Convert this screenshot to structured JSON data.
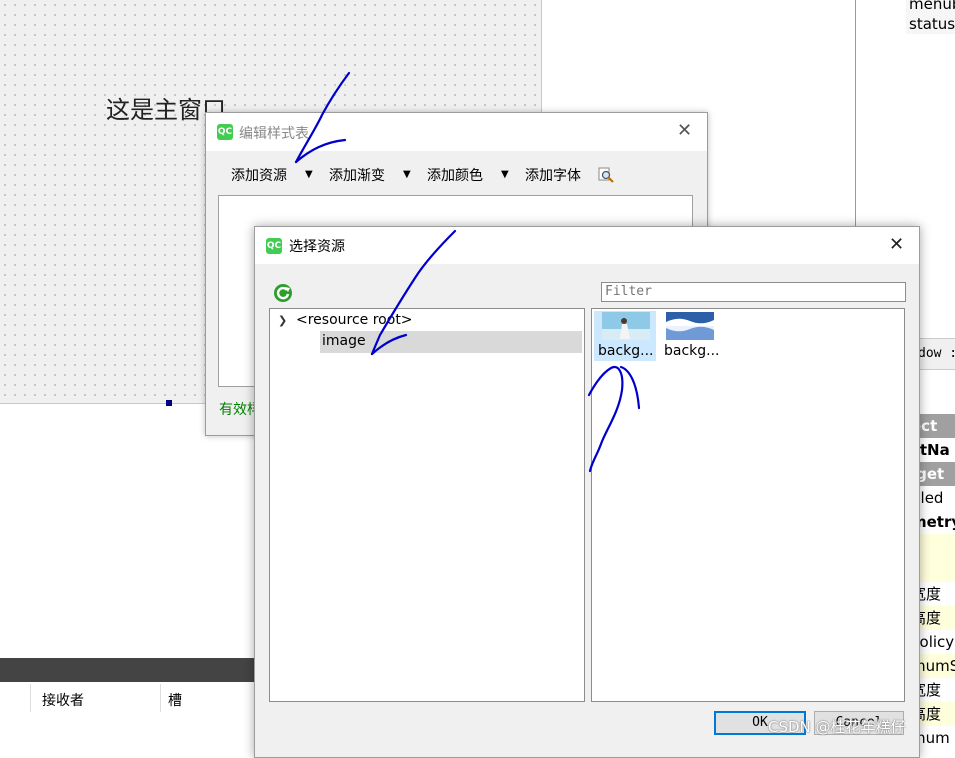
{
  "canvas": {
    "main_label": "这是主窗口"
  },
  "object_list": {
    "items": [
      "menub",
      "statusb"
    ]
  },
  "property_panel": {
    "header": "dow :",
    "rows": [
      "ect",
      "ctNa",
      "lget",
      "bled",
      "metry",
      "",
      "",
      "宽度",
      "高度",
      "Policy",
      "mumS",
      "宽度",
      "高度",
      "mum"
    ]
  },
  "signal_panel": {
    "col_receiver": "接收者",
    "col_slot": "槽"
  },
  "stylesheet_dialog": {
    "title": "编辑样式表",
    "icon_text": "QC",
    "toolbar": {
      "add_resource": "添加资源",
      "add_gradient": "添加渐变",
      "add_color": "添加颜色",
      "add_font": "添加字体"
    },
    "arrow": "▼",
    "valid_text": "有效样"
  },
  "resource_dialog": {
    "title": "选择资源",
    "icon_text": "QC",
    "filter_placeholder": "Filter",
    "tree": {
      "root": "<resource root>",
      "child": "image"
    },
    "files": [
      {
        "name": "backg...",
        "selected": true
      },
      {
        "name": "backg...",
        "selected": false
      }
    ],
    "ok_label": "OK",
    "cancel_label": "Cancel"
  },
  "watermark": "CSDN @桂花年糕仔",
  "colors": {
    "accent": "#0078d7",
    "qt_green": "#41cd52",
    "valid_green": "#008000",
    "scribble": "#0000cc"
  }
}
